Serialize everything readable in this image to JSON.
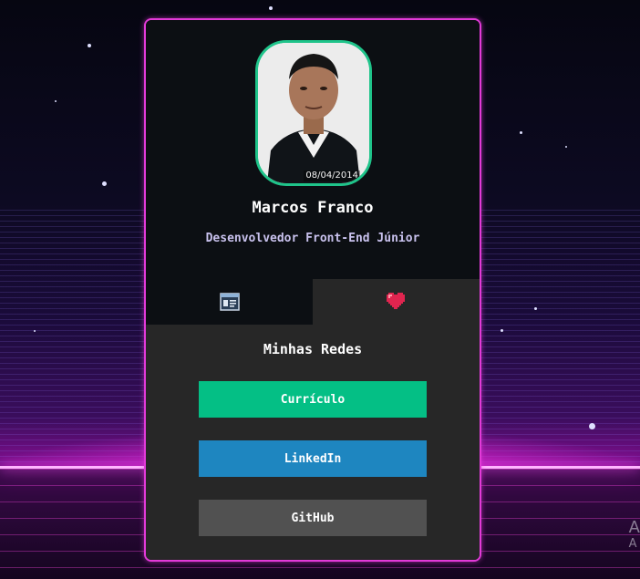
{
  "profile": {
    "name": "Marcos Franco",
    "role": "Desenvolvedor Front-End Júnior",
    "photo_date_stamp": "08/04/2014",
    "accent_border": "#1fc48a"
  },
  "tabs": [
    {
      "icon": "id-card-icon",
      "active": false
    },
    {
      "icon": "heart-icon",
      "active": true
    }
  ],
  "social": {
    "title": "Minhas Redes",
    "buttons": [
      {
        "label": "Currículo",
        "color": "#04bf85"
      },
      {
        "label": "LinkedIn",
        "color": "#1e86c0"
      },
      {
        "label": "GitHub",
        "color": "#515151"
      }
    ]
  },
  "card_border_color": "#e23ad8",
  "watermark": [
    "A",
    "A"
  ]
}
